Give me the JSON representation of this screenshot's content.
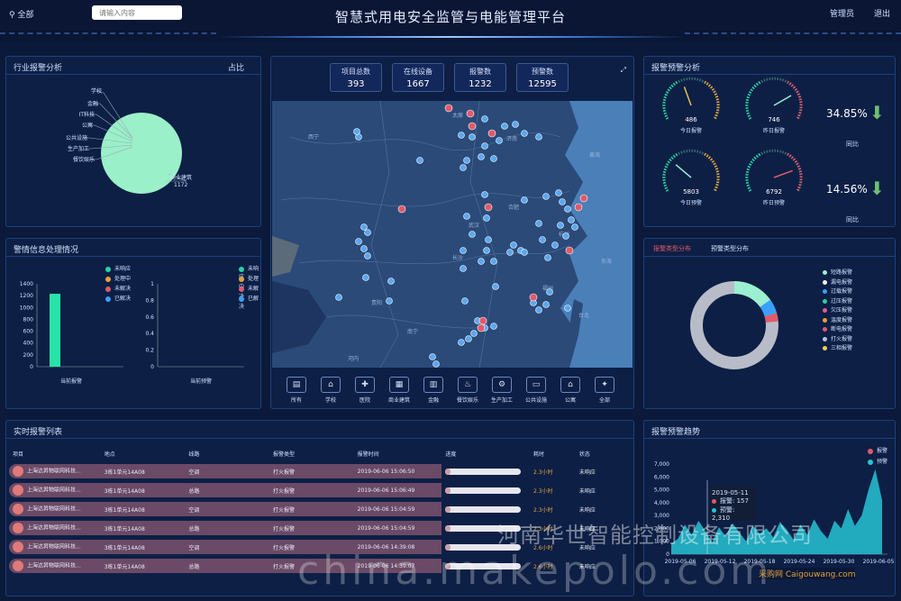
{
  "header": {
    "location": "全部",
    "search_placeholder": "请输入内容",
    "title": "智慧式用电安全监管与电能管理平台",
    "user": "管理员",
    "logout": "退出"
  },
  "industry": {
    "title": "行业报警分析",
    "toggle": "占比",
    "labels": [
      "学校",
      "金融",
      "IT科技",
      "公寓",
      "公共设施",
      "生产加工",
      "餐饮娱乐"
    ],
    "main_label": "商业建筑",
    "main_value": "1172"
  },
  "processing": {
    "title": "警情信息处理情况",
    "legend": [
      "未响应",
      "处理中",
      "未解决",
      "已解决"
    ],
    "legend_colors": [
      "#27d3a0",
      "#e6a23c",
      "#e05a6a",
      "#3aa0ff"
    ],
    "left_axis": [
      "1400",
      "1200",
      "1000",
      "800",
      "600",
      "400",
      "200",
      "0"
    ],
    "left_label": "当前报警",
    "left_bar_value": 1232,
    "right_axis": [
      "1",
      "0.8",
      "0.6",
      "0.4",
      "0.2",
      "0"
    ],
    "right_label": "当前预警"
  },
  "stats": [
    {
      "label": "项目总数",
      "value": "393"
    },
    {
      "label": "在线设备",
      "value": "1667"
    },
    {
      "label": "报警数",
      "value": "1232"
    },
    {
      "label": "预警数",
      "value": "12595"
    }
  ],
  "map_labels": [
    "西宁",
    "太原",
    "济南",
    "合肥",
    "武汉",
    "长沙",
    "杭州",
    "南宁",
    "贵阳",
    "福州",
    "台北",
    "河内",
    "黄海",
    "东海"
  ],
  "toolbar": [
    "所有",
    "学校",
    "医院",
    "商业建筑",
    "金融",
    "餐饮娱乐",
    "生产加工",
    "公共设施",
    "公寓",
    "全部"
  ],
  "alarm_analysis": {
    "title": "报警预警分析",
    "gauges": [
      {
        "value": "486",
        "label": "今日报警"
      },
      {
        "value": "746",
        "label": "昨日报警"
      },
      {
        "value": "5803",
        "label": "今日预警"
      },
      {
        "value": "6792",
        "label": "昨日预警"
      }
    ],
    "pct1": "34.85%",
    "pct2": "14.56%",
    "tongbi": "同比"
  },
  "type_dist": {
    "tab1": "报警类型分布",
    "tab2": "预警类型分布",
    "legend": [
      "短路报警",
      "漏电报警",
      "过载报警",
      "过压报警",
      "欠压报警",
      "温度报警",
      "断电报警",
      "打火报警",
      "三相报警"
    ],
    "legend_colors": [
      "#9af0d0",
      "#ffffff",
      "#3aa0ff",
      "#27d3a0",
      "#e05aa0",
      "#e6a23c",
      "#e05a6a",
      "#b0c4de",
      "#f0d050"
    ]
  },
  "alarm_list": {
    "title": "实时报警列表",
    "headers": [
      "项目",
      "地点",
      "线路",
      "报警类型",
      "报警时间",
      "进度",
      "耗时",
      "状态"
    ],
    "rows": [
      [
        "上海达昇物联网科技...",
        "3栋1单元14A08",
        "空调",
        "打火报警",
        "2019-06-06 15:06:50",
        "2.3小时",
        "未响应"
      ],
      [
        "上海达昇物联网科技...",
        "3栋1单元14A08",
        "总路",
        "打火报警",
        "2019-06-06 15:06:49",
        "2.3小时",
        "未响应"
      ],
      [
        "上海达昇物联网科技...",
        "3栋1单元14A08",
        "空调",
        "打火报警",
        "2019-06-06 15:04:59",
        "2.3小时",
        "未响应"
      ],
      [
        "上海达昇物联网科技...",
        "3栋1单元14A08",
        "总路",
        "打火报警",
        "2019-06-06 15:04:59",
        "2.3小时",
        "未响应"
      ],
      [
        "上海达昇物联网科技...",
        "3栋1单元14A08",
        "空调",
        "打火报警",
        "2019-06-06 14:39:08",
        "2.6小时",
        "未响应"
      ],
      [
        "上海达昇物联网科技...",
        "3栋1单元14A08",
        "总路",
        "打火报警",
        "2019-06-06 14:39:07",
        "2.6小时",
        "未响应"
      ]
    ]
  },
  "trend": {
    "title": "报警预警趋势",
    "legend": [
      "报警",
      "预警"
    ],
    "y_ticks": [
      "7,000",
      "6,000",
      "5,000",
      "4,000",
      "3,000",
      "2,000",
      "1,000",
      "0"
    ],
    "x_ticks": [
      "2019-05-06",
      "2019-05-12",
      "2019-05-18",
      "2019-05-24",
      "2019-05-30",
      "2019-06-05"
    ],
    "tooltip_date": "2019-05-11",
    "tooltip_alarm": "报警: 157",
    "tooltip_warn": "预警: 2,310"
  },
  "watermark": {
    "line1": "河南华世智能控制设备有限公司",
    "line2": "china.makepolo.com",
    "line3": "采购网 Caigouwang.com"
  }
}
